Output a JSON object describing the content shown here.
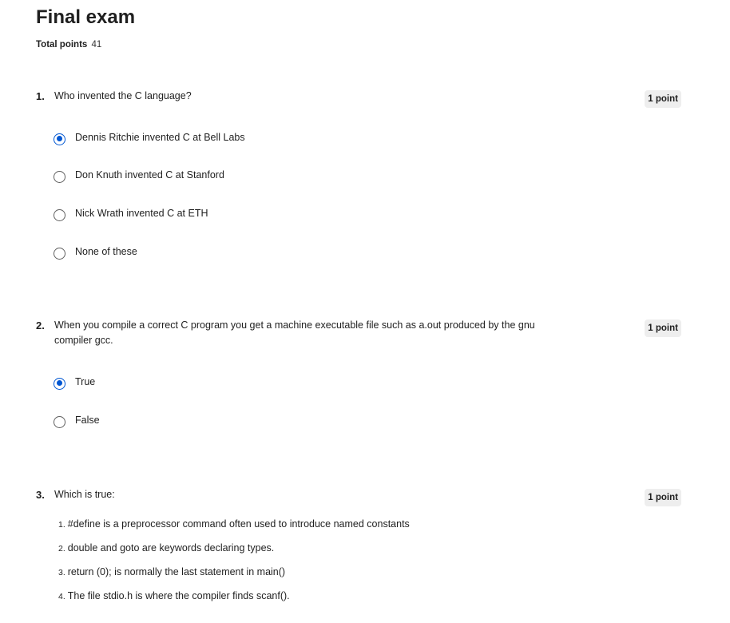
{
  "exam": {
    "title": "Final exam",
    "total_points_label": "Total points",
    "total_points_value": "41"
  },
  "questions": [
    {
      "number": "1.",
      "text": "Who invented the C language?",
      "points": "1 point",
      "options": [
        {
          "label": "Dennis Ritchie invented C at Bell Labs",
          "selected": true
        },
        {
          "label": "Don Knuth invented C at Stanford",
          "selected": false
        },
        {
          "label": "Nick Wrath invented C at ETH",
          "selected": false
        },
        {
          "label": "None of these",
          "selected": false
        }
      ]
    },
    {
      "number": "2.",
      "text": "When you compile a correct C program you get a machine executable file such as a.out produced by the gnu compiler gcc.",
      "points": "1 point",
      "options": [
        {
          "label": "True",
          "selected": true
        },
        {
          "label": "False",
          "selected": false
        }
      ]
    },
    {
      "number": "3.",
      "text": "Which is true:",
      "points": "1 point",
      "statements": [
        {
          "index": "1.",
          "text": "#define is a preprocessor command often used to introduce named constants"
        },
        {
          "index": "2.",
          "text": "double and goto are keywords declaring types."
        },
        {
          "index": "3.",
          "text": "return (0); is normally the last statement in main()"
        },
        {
          "index": "4.",
          "text": "The file stdio.h is where the compiler finds scanf()."
        }
      ]
    }
  ],
  "colors": {
    "accent": "#0056d2",
    "points_badge_bg": "#eeeeee",
    "text": "#1f1f1f"
  }
}
